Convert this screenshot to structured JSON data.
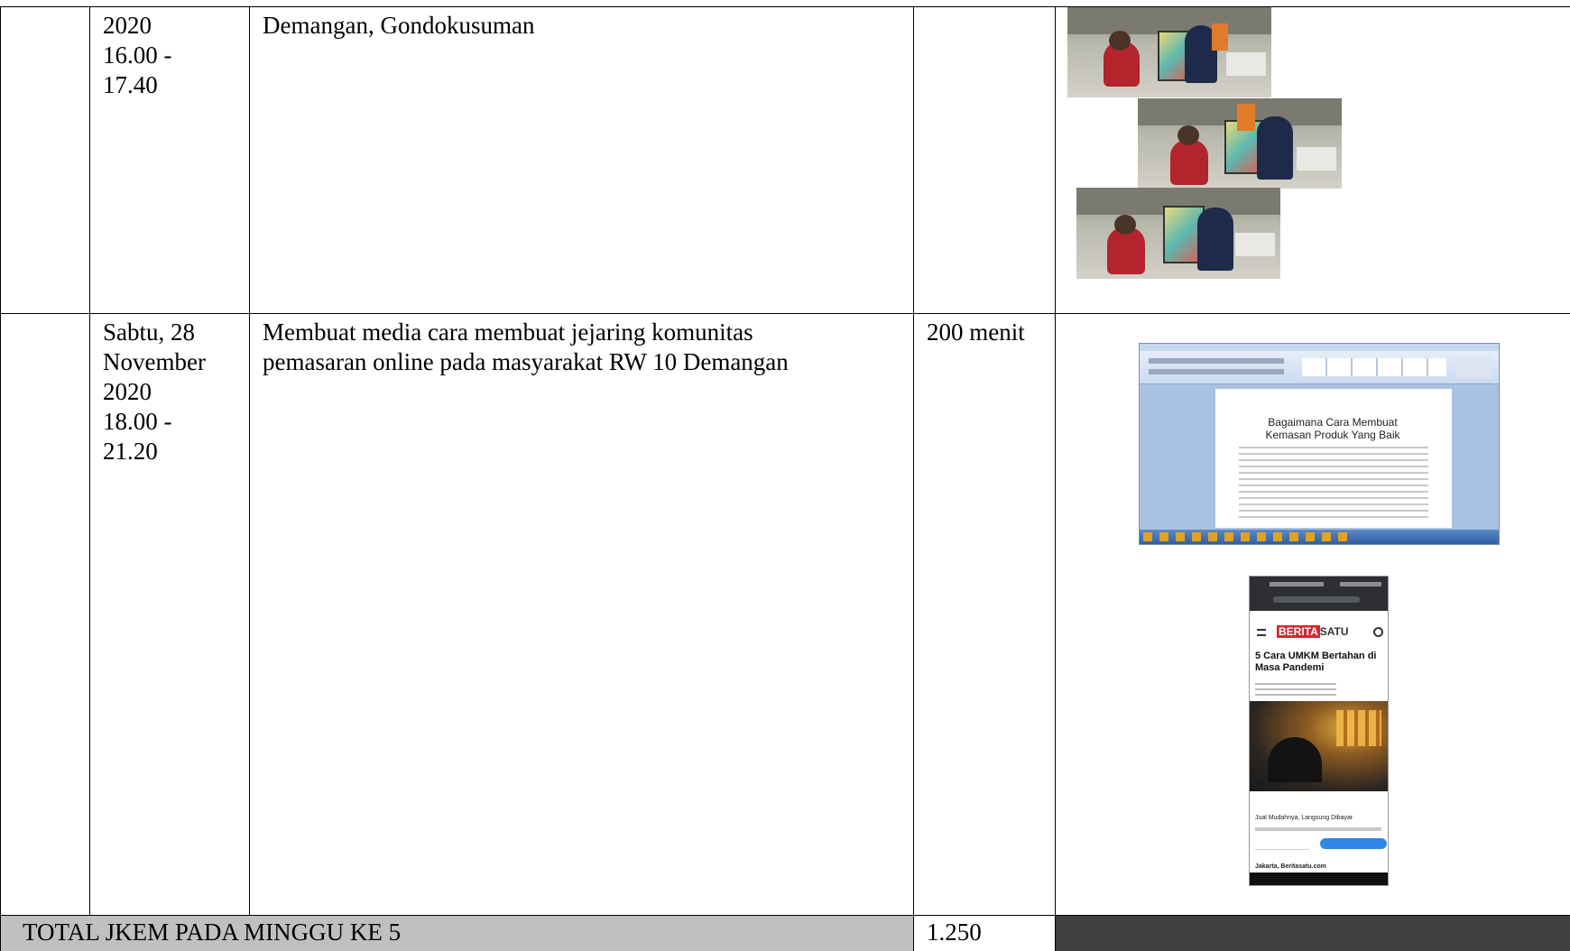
{
  "rows": [
    {
      "date": "2020\n16.00 -\n17.40",
      "activity": "Demangan, Gondokusuman",
      "duration": ""
    },
    {
      "date": "Sabtu, 28\nNovember\n2020\n18.00 -\n21.20",
      "activity": "Membuat media cara membuat jejaring komunitas\npemasaran online pada masyarakat RW 10 Demangan",
      "duration": "200 menit",
      "word_doc": {
        "title": "Bagaimana Cara Membuat\nKemasan Produk Yang Baik"
      },
      "news_phone": {
        "brand_highlight": "BERITA",
        "brand_rest": "SATU",
        "headline": "5 Cara UMKM Bertahan di\nMasa Pandemi",
        "subheading": "Jual Mudahnya, Langsung Dibayar",
        "footer_text": "Jakarta, Beritasatu.com"
      }
    }
  ],
  "total": {
    "label": "TOTAL JKEM PADA MINGGU KE 5",
    "value": "1.250"
  },
  "colors": {
    "total_bg": "#c0c0c0",
    "dark_cell": "#404040",
    "word_blue": "#a9c1e2",
    "news_red": "#d7262c",
    "phone_bar": "#2d2f33",
    "button_blue": "#2f86e6"
  }
}
